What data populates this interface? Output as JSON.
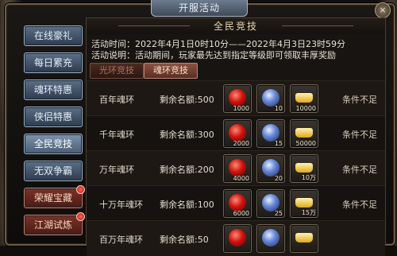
{
  "window": {
    "title": "开服活动",
    "close_icon": "×"
  },
  "sidebar": {
    "items": [
      {
        "label": "在线豪礼",
        "badge": false
      },
      {
        "label": "每日累充",
        "badge": false
      },
      {
        "label": "魂环特惠",
        "badge": false
      },
      {
        "label": "侠侣特惠",
        "badge": false
      },
      {
        "label": "全民竞技",
        "badge": false,
        "active": true
      },
      {
        "label": "无双争霸",
        "badge": false
      },
      {
        "label": "荣耀宝藏",
        "badge": true
      },
      {
        "label": "江湖试炼",
        "badge": true
      }
    ]
  },
  "panel": {
    "title": "全民竞技",
    "time_line": "活动时间：2022年4月1日0时10分——2022年4月3日23时59分",
    "desc_line": "活动说明：活动期间，玩家最先达到指定等级即可领取丰厚奖励",
    "tabs": [
      {
        "label": "光环竞技"
      },
      {
        "label": "魂环竞技",
        "active": true
      }
    ]
  },
  "rows": [
    {
      "name": "百年魂环",
      "remaining": "剩余名额:500",
      "rewards": [
        "1000",
        "10",
        "10000"
      ],
      "status": "条件不足"
    },
    {
      "name": "千年魂环",
      "remaining": "剩余名额:300",
      "rewards": [
        "2000",
        "15",
        "50000"
      ],
      "status": "条件不足"
    },
    {
      "name": "万年魂环",
      "remaining": "剩余名额:200",
      "rewards": [
        "4000",
        "20",
        "10万"
      ],
      "status": "条件不足"
    },
    {
      "name": "十万年魂环",
      "remaining": "剩余名额:100",
      "rewards": [
        "6000",
        "25",
        "15万"
      ],
      "status": "条件不足"
    },
    {
      "name": "百万年魂环",
      "remaining": "剩余名额:50",
      "rewards": [
        "",
        "",
        ""
      ],
      "status": ""
    }
  ],
  "colors": {
    "accent_red": "#c0261b",
    "frame": "#6b5a44",
    "sidebar_blue": "#4a5d75"
  }
}
